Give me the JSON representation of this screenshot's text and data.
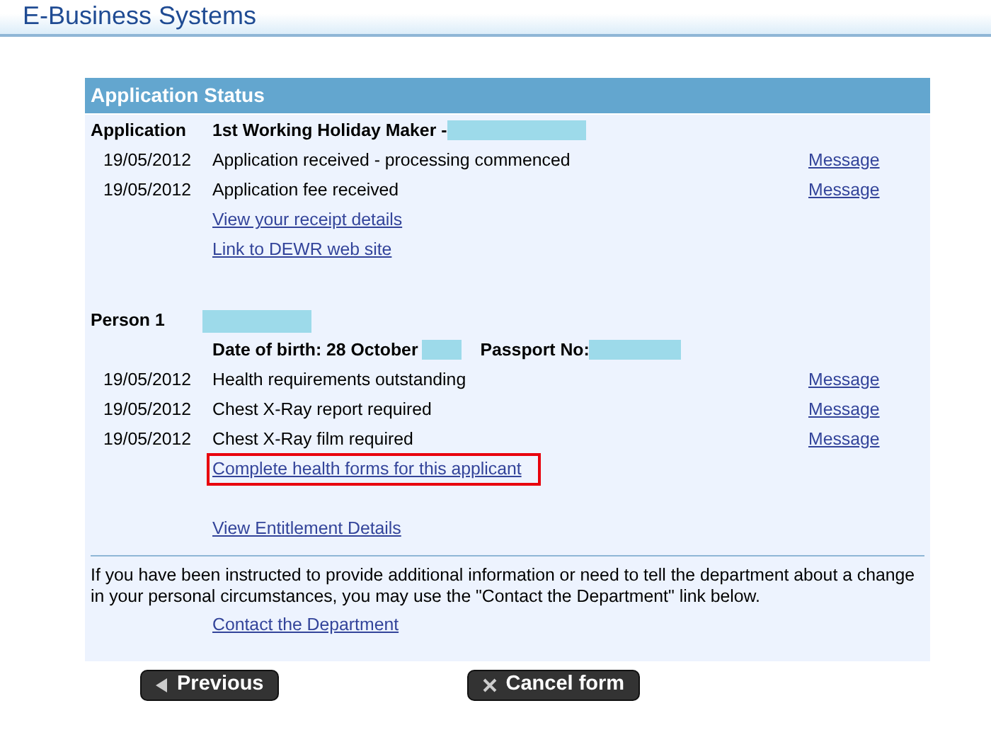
{
  "header": {
    "title": "E-Business Systems"
  },
  "panel": {
    "title": "Application Status",
    "sections": [
      {
        "label": "Application",
        "title": "1st Working Holiday Maker -",
        "title_redacted": true,
        "label_redacted": false,
        "items": [
          {
            "kind": "event",
            "date": "19/05/2012",
            "text": "Application received - processing commenced",
            "action": "Message"
          },
          {
            "kind": "event",
            "date": "19/05/2012",
            "text": "Application fee received",
            "action": "Message"
          },
          {
            "kind": "link",
            "text": "View your receipt details",
            "highlighted": false,
            "spaced_above": false
          },
          {
            "kind": "link",
            "text": "Link to DEWR web site",
            "highlighted": false,
            "spaced_above": false
          }
        ]
      },
      {
        "label": "Person 1",
        "label_redacted": true,
        "details": [
          {
            "text": "Date of birth: 28 October",
            "redacted": true
          },
          {
            "text": "Passport No:",
            "redacted": true
          }
        ],
        "items": [
          {
            "kind": "event",
            "date": "19/05/2012",
            "text": "Health requirements outstanding",
            "action": "Message"
          },
          {
            "kind": "event",
            "date": "19/05/2012",
            "text": "Chest X-Ray report required",
            "action": "Message"
          },
          {
            "kind": "event",
            "date": "19/05/2012",
            "text": "Chest X-Ray film required",
            "action": "Message"
          },
          {
            "kind": "link",
            "text": "Complete health forms for this applicant",
            "highlighted": true,
            "spaced_above": false
          },
          {
            "kind": "link",
            "text": "View Entitlement Details",
            "highlighted": false,
            "spaced_above": true
          }
        ]
      }
    ],
    "note": "If you have been instructed to provide additional information or need to tell the department about a change in your personal circumstances, you may use the \"Contact the Department\" link below.",
    "contact_link": "Contact the Department"
  },
  "buttons": [
    {
      "kind": "previous",
      "label": "Previous"
    },
    {
      "kind": "cancel",
      "label": "Cancel form"
    }
  ]
}
